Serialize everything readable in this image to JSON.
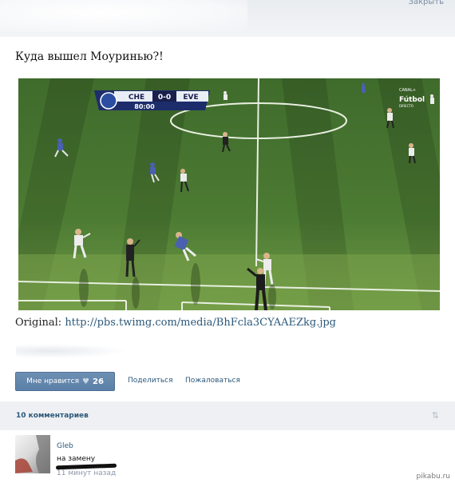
{
  "header": {
    "close_label": "Закрыть"
  },
  "post": {
    "title": "Куда вышел Моуринью?!",
    "image": {
      "scoreboard": {
        "home": "CHE",
        "score": "0-0",
        "away": "EVE",
        "clock": "80:00"
      },
      "broadcaster": {
        "line1": "CANAL+",
        "line2": "Fútbol",
        "line3": "DIRECTO"
      }
    },
    "original_label": "Original:",
    "original_link": "http://pbs.twimg.com/media/BhFcla3CYAAEZkg.jpg"
  },
  "actions": {
    "like_label": "Мне нравится",
    "like_count": "26",
    "share_label": "Поделиться",
    "report_label": "Пожаловаться"
  },
  "comments": {
    "count_label": "10 комментариев",
    "items": [
      {
        "author": "Gleb",
        "text": "на замену",
        "time": "11 минут назад"
      }
    ]
  },
  "watermark": "pikabu.ru",
  "colors": {
    "link": "#2b587a",
    "button": "#5b7fa6",
    "pitch": "#3d6a2a"
  }
}
